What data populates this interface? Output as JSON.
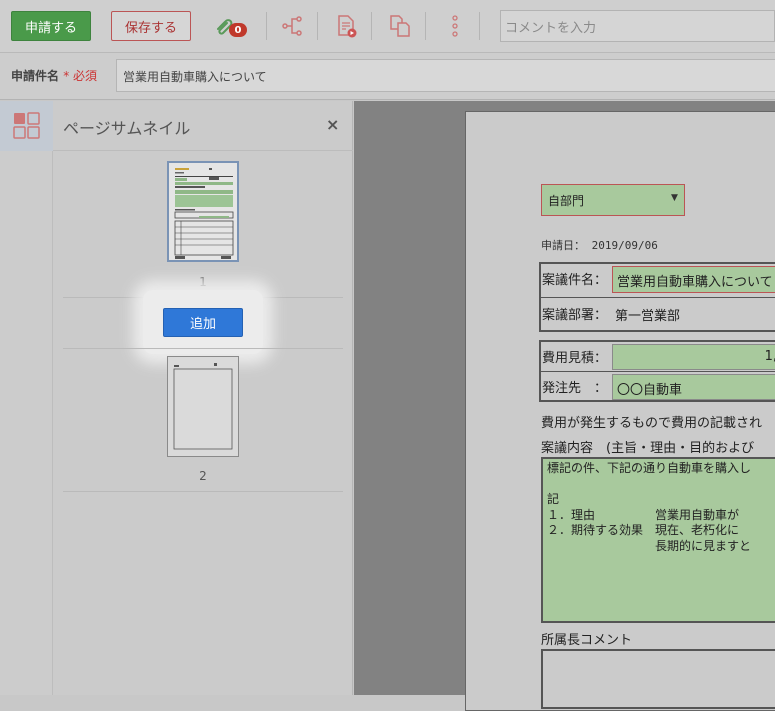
{
  "toolbar": {
    "apply_label": "申請する",
    "save_label": "保存する",
    "attachment_count": "0",
    "comment_placeholder": "コメントを入力",
    "icons": [
      "paperclip-icon",
      "route-icon",
      "document-play-icon",
      "copy-pages-icon",
      "more-vertical-icon"
    ]
  },
  "subject": {
    "label": "申請件名",
    "required_mark": "*",
    "required_text": "必須",
    "value": "営業用自動車購入について"
  },
  "thumbnail_panel": {
    "title": "ページサムネイル",
    "close_label": "×",
    "pages": [
      {
        "number": "1"
      },
      {
        "number": "2"
      }
    ],
    "add_label": "追加"
  },
  "document": {
    "department": "自部門",
    "date_label": "申請日：",
    "date_value": "2019/09/06",
    "subject_label": "案議件名：",
    "subject_value": "営業用自動車購入について",
    "dept_label": "案議部署：",
    "dept_value": "第一営業部",
    "cost_label": "費用見積：",
    "cost_value": "1,",
    "vendor_label": "発注先　：",
    "vendor_value": "〇〇自動車",
    "note_text": "費用が発生するもので費用の記載され",
    "content_label": "案議内容　(主旨・理由・目的および",
    "content_lines": [
      "標記の件、下記の通り自動車を購入し",
      "",
      "記",
      "１．理由　　　　　営業用自動車が",
      "２．期待する効果　現在、老朽化に",
      "　　　　　　　　　長期的に見ますと"
    ],
    "comment_label": "所属長コメント"
  },
  "colors": {
    "apply_green": "#4a9a4a",
    "save_red": "#a33333",
    "add_blue": "#2f78d8",
    "field_green": "#a8c99d"
  }
}
